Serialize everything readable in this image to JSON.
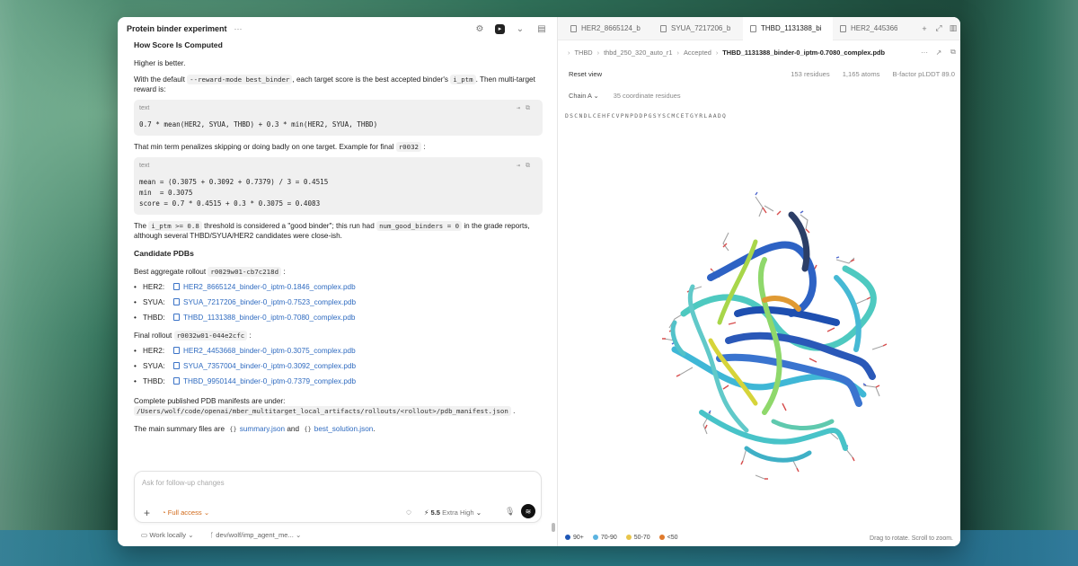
{
  "colors": {
    "link": "#2f6bc0",
    "access": "#d16a1a",
    "legend_90": "#1e57b6",
    "legend_70_90": "#5bb3e0",
    "legend_50_70": "#e8c54a",
    "legend_lt50": "#e07a2c"
  },
  "left_header": {
    "title": "Protein binder experiment",
    "dots": "···",
    "icons": [
      "gear-icon",
      "terminal-icon",
      "panel-icon"
    ]
  },
  "content": {
    "heading_score": "How Score Is Computed",
    "higher_better": "Higher is better.",
    "p1_a": "With the default",
    "p1_code1": "--reward-mode best_binder",
    "p1_b": ", each target score is the best accepted binder's",
    "p1_code2": "i_ptm",
    "p1_c": ". Then multi-target reward is:",
    "code1_lang": "text",
    "code1_body": "0.7 * mean(HER2, SYUA, THBD) + 0.3 * min(HER2, SYUA, THBD)",
    "p2_a": "That min term penalizes skipping or doing badly on one target. Example for final",
    "p2_code": "r0032",
    "p2_b": ":",
    "code2_lang": "text",
    "code2_body": "mean = (0.3075 + 0.3092 + 0.7379) / 3 = 0.4515\nmin  = 0.3075\nscore = 0.7 * 0.4515 + 0.3 * 0.3075 = 0.4083",
    "p3_a": "The",
    "p3_code1": "i_ptm >= 0.8",
    "p3_b": "threshold is considered a \"good binder\"; this run had",
    "p3_code2": "num_good_binders = 0",
    "p3_c": "in the grade reports, although several THBD/SYUA/HER2 candidates were close-ish.",
    "heading_candidates": "Candidate PDBs",
    "best_rollout_a": "Best aggregate rollout",
    "best_rollout_code": "r0029w01-cb7c218d",
    "best_rollout_b": ":",
    "best_files": [
      {
        "label": "HER2:",
        "file": "HER2_8665124_binder-0_iptm-0.1846_complex.pdb"
      },
      {
        "label": "SYUA:",
        "file": "SYUA_7217206_binder-0_iptm-0.7523_complex.pdb"
      },
      {
        "label": "THBD:",
        "file": "THBD_1131388_binder-0_iptm-0.7080_complex.pdb"
      }
    ],
    "final_rollout_a": "Final rollout",
    "final_rollout_code": "r0032w01-044e2cfc",
    "final_rollout_b": ":",
    "final_files": [
      {
        "label": "HER2:",
        "file": "HER2_4453668_binder-0_iptm-0.3075_complex.pdb"
      },
      {
        "label": "SYUA:",
        "file": "SYUA_7357004_binder-0_iptm-0.3092_complex.pdb"
      },
      {
        "label": "THBD:",
        "file": "THBD_9950144_binder-0_iptm-0.7379_complex.pdb"
      }
    ],
    "manifest_a": "Complete published PDB manifests are under:",
    "manifest_code": "/Users/wolf/code/openai/mber_multitarget_local_artifacts/rollouts/<rollout>/pdb_manifest.json",
    "manifest_b": ".",
    "summary_a": "The main summary files are",
    "summary_file1": "summary.json",
    "summary_and": "and",
    "summary_file2": "best_solution.json",
    "summary_b": "."
  },
  "composer": {
    "placeholder": "Ask for follow-up changes",
    "access": "Full access",
    "model": "5.5",
    "effort": "Extra High"
  },
  "footer": {
    "work": "Work locally",
    "branch": "dev/wolf/imp_agent_me..."
  },
  "tabs": [
    {
      "label": "HER2_8665124_b",
      "active": false
    },
    {
      "label": "SYUA_7217206_b",
      "active": false
    },
    {
      "label": "THBD_1131388_bi",
      "active": true
    },
    {
      "label": "HER2_4453668",
      "active": false
    }
  ],
  "breadcrumbs": [
    "THBD",
    "thbd_250_320_auto_r1",
    "Accepted",
    "THBD_1131388_binder-0_iptm-0.7080_complex.pdb"
  ],
  "viewer": {
    "reset": "Reset view",
    "residues": "153 residues",
    "atoms": "1,165 atoms",
    "plddt": "B-factor pLDDT 89.0",
    "chain": "Chain A",
    "coord_residues": "35 coordinate residues",
    "sequence": "DSCNDLCEHFCVPNPDDPGSYSCMCETGYRLAADQ",
    "legend": [
      {
        "label": "90+",
        "color": "#1e57b6"
      },
      {
        "label": "70-90",
        "color": "#5bb3e0"
      },
      {
        "label": "50-70",
        "color": "#e8c54a"
      },
      {
        "label": "<50",
        "color": "#e07a2c"
      }
    ],
    "hint": "Drag to rotate. Scroll to zoom."
  }
}
